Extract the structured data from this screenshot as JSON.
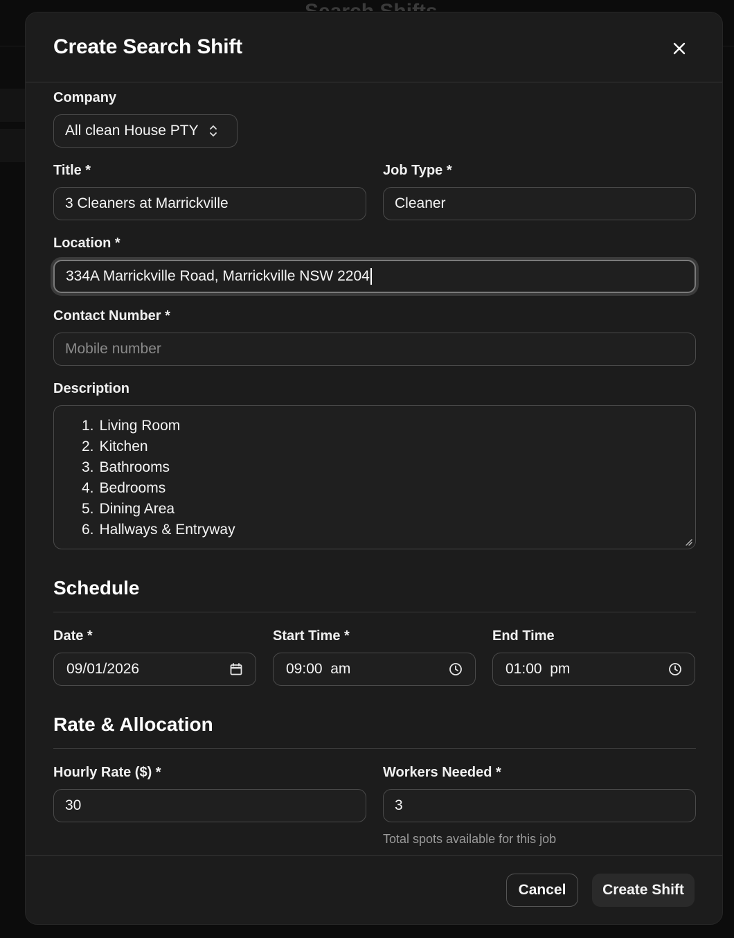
{
  "background": {
    "page_title": "Search Shifts"
  },
  "modal": {
    "title": "Create Search Shift",
    "close_icon": "close-icon"
  },
  "form": {
    "company": {
      "label": "Company",
      "value": "All clean House PTY"
    },
    "title": {
      "label": "Title *",
      "value": "3 Cleaners at Marrickville"
    },
    "job_type": {
      "label": "Job Type *",
      "value": "Cleaner"
    },
    "location": {
      "label": "Location *",
      "value": "334A Marrickville Road, Marrickville NSW 2204"
    },
    "contact_number": {
      "label": "Contact Number *",
      "value": "",
      "placeholder": "Mobile number"
    },
    "description": {
      "label": "Description",
      "items": [
        {
          "num": "1.",
          "text": "Living Room"
        },
        {
          "num": "2.",
          "text": "Kitchen"
        },
        {
          "num": "3.",
          "text": "Bathrooms"
        },
        {
          "num": "4.",
          "text": "Bedrooms"
        },
        {
          "num": "5.",
          "text": "Dining Area"
        },
        {
          "num": "6.",
          "text": "Hallways & Entryway"
        }
      ]
    }
  },
  "schedule": {
    "title": "Schedule",
    "date": {
      "label": "Date *",
      "value": "09/01/2026"
    },
    "start_time": {
      "label": "Start Time *",
      "value": "09:00  am"
    },
    "end_time": {
      "label": "End Time",
      "value": "01:00  pm"
    }
  },
  "rate": {
    "title": "Rate & Allocation",
    "hourly_rate": {
      "label": "Hourly Rate ($) *",
      "value": "30"
    },
    "workers_needed": {
      "label": "Workers Needed *",
      "value": "3",
      "helper": "Total spots available for this job"
    }
  },
  "footer": {
    "cancel_label": "Cancel",
    "create_label": "Create Shift"
  }
}
